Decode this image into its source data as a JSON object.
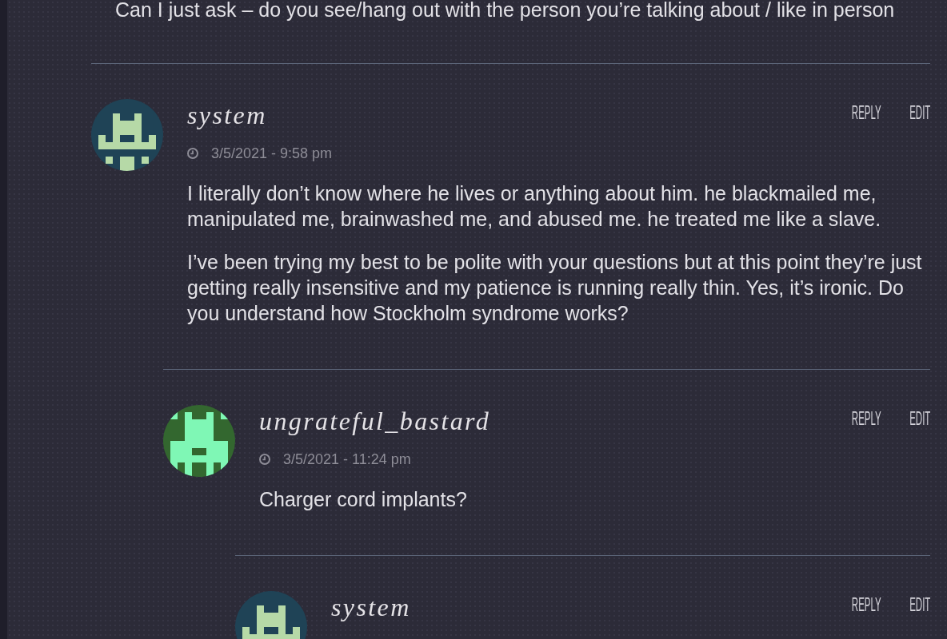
{
  "parent_comment_excerpt": "Can I just ask – do you see/hang out with the person you’re talking about / like in person",
  "thread": [
    {
      "author": "system",
      "avatar": {
        "kind": "castle"
      },
      "date": "3/5/2021 - 9:58 pm",
      "body": [
        "I literally don’t know where he lives or anything about him. he blackmailed me, manipulated me, brainwashed me, and abused me. he treated me like a slave.",
        "I’ve been trying my best to be polite with your questions but at this point they’re just getting really insensitive and my patience is running really thin. Yes, it’s ironic. Do you understand how Stockholm syndrome works?"
      ],
      "actions": [
        "REPLY",
        "EDIT"
      ],
      "children": [
        {
          "author": "ungrateful_bastard",
          "avatar": {
            "kind": "invader"
          },
          "date": "3/5/2021 - 11:24 pm",
          "body": [
            "Charger cord implants?"
          ],
          "actions": [
            "REPLY",
            "EDIT"
          ],
          "children": [
            {
              "author": "system",
              "avatar": {
                "kind": "castle"
              },
              "actions": [
                "REPLY",
                "EDIT"
              ]
            }
          ]
        }
      ]
    }
  ]
}
